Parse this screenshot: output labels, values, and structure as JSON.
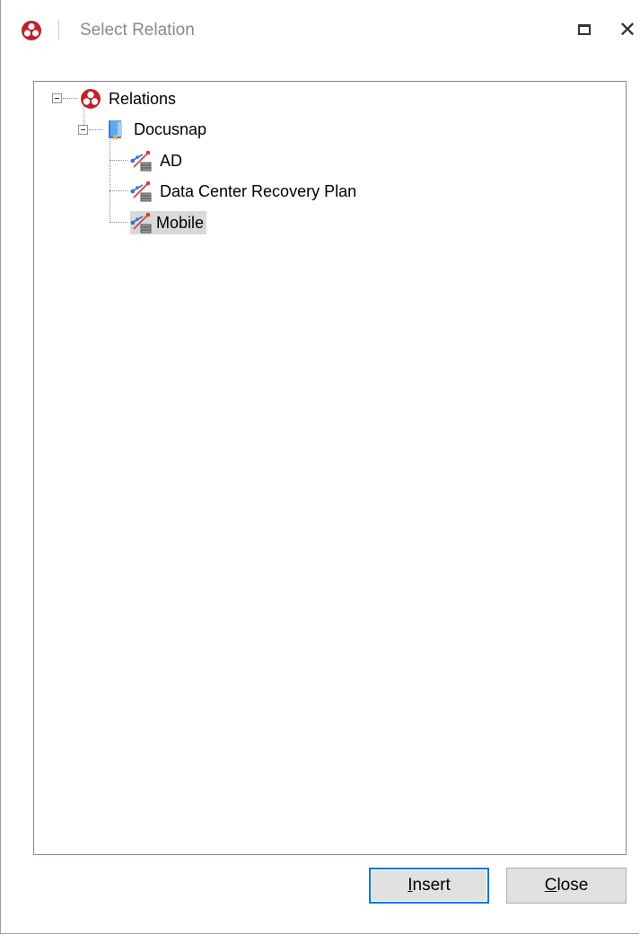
{
  "window": {
    "title": "Select Relation"
  },
  "tree": {
    "root": {
      "label": "Relations",
      "icon": "relations-icon"
    },
    "workspace": {
      "label": "Docusnap",
      "icon": "docusnap-book-icon"
    },
    "items": [
      {
        "label": "AD",
        "icon": "relation-diagram-icon",
        "selected": false
      },
      {
        "label": "Data Center Recovery Plan",
        "icon": "relation-diagram-icon",
        "selected": false
      },
      {
        "label": "Mobile",
        "icon": "relation-diagram-icon",
        "selected": true
      }
    ]
  },
  "buttons": {
    "insert": {
      "underline": "I",
      "rest": "nsert"
    },
    "close": {
      "underline": "C",
      "rest": "lose"
    }
  },
  "colors": {
    "accent": "#0078d7",
    "selection": "#d9d9d9",
    "brand_red": "#c0202a"
  }
}
